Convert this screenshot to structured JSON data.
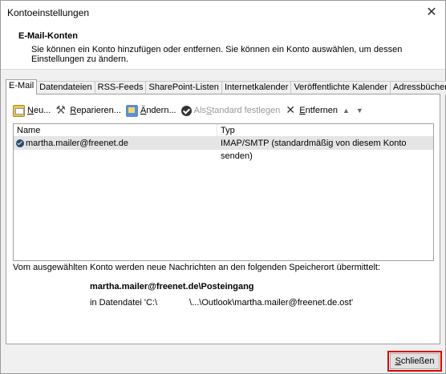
{
  "window": {
    "title": "Kontoeinstellungen",
    "close_glyph": "✕"
  },
  "header": {
    "title": "E-Mail-Konten",
    "description": "Sie können ein Konto hinzufügen oder entfernen. Sie können ein Konto auswählen, um dessen Einstellungen zu ändern."
  },
  "tabs": [
    {
      "label": "E-Mail"
    },
    {
      "label": "Datendateien"
    },
    {
      "label": "RSS-Feeds"
    },
    {
      "label": "SharePoint-Listen"
    },
    {
      "label": "Internetkalender"
    },
    {
      "label": "Veröffentlichte Kalender"
    },
    {
      "label": "Adressbücher"
    }
  ],
  "toolbar": {
    "new_label_u": "N",
    "new_label_rest": "eu...",
    "repair_label_u": "R",
    "repair_label_rest": "eparieren...",
    "change_label_u": "Ä",
    "change_label_rest": "ndern...",
    "default_label_a": "Als ",
    "default_label_u": "S",
    "default_label_b": "tandard festlegen",
    "remove_label_u": "E",
    "remove_label_rest": "ntfernen",
    "up_arrow": "▲",
    "down_arrow": "▼"
  },
  "list": {
    "columns": {
      "name": "Name",
      "type": "Typ"
    },
    "rows": [
      {
        "name": "martha.mailer@freenet.de",
        "type": "IMAP/SMTP (standardmäßig von diesem Konto senden)"
      }
    ]
  },
  "info": {
    "text": "Vom ausgewählten Konto werden neue Nachrichten an den folgenden Speicherort übermittelt:",
    "store_path": "martha.mailer@freenet.de\\Posteingang",
    "data_file_prefix": "in Datendatei 'C:\\",
    "data_file_suffix": "\\...\\Outlook\\martha.mailer@freenet.de.ost'"
  },
  "footer": {
    "close_label_u": "S",
    "close_label_rest": "chließen"
  }
}
